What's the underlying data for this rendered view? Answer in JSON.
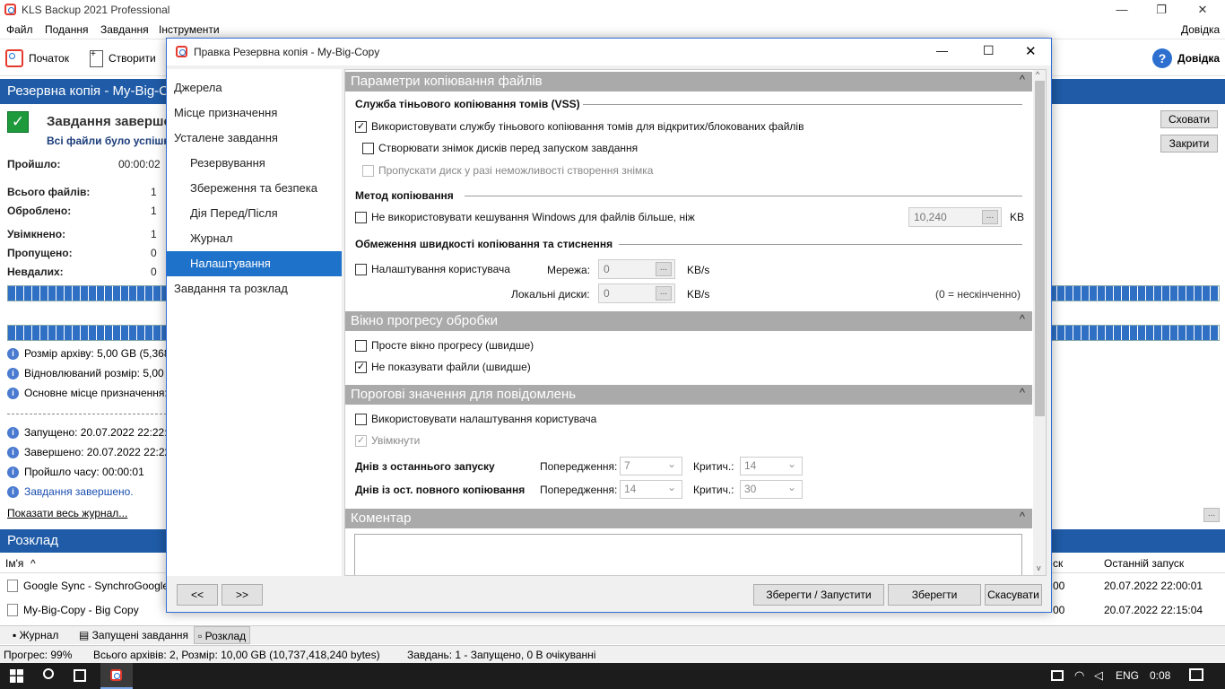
{
  "app": {
    "title": "KLS Backup 2021 Professional",
    "win_min": "—",
    "win_restore": "❐",
    "win_close": "✕"
  },
  "menu": {
    "items": [
      "Файл",
      "Подання",
      "Завдання",
      "Інструменти"
    ],
    "help": "Довідка"
  },
  "toolbar": {
    "start": "Початок",
    "create": "Створити",
    "help": "Довідка",
    "plus": "+",
    "question": "?"
  },
  "header": {
    "title": "Резервна копія - My-Big-C"
  },
  "task": {
    "status_title": "Завдання заверше",
    "status_sub": "Всі файли було успішн",
    "check": "✓"
  },
  "stats": {
    "elapsed_label": "Пройшло:",
    "elapsed_value": "00:00:02",
    "total_label": "Всього файлів:",
    "total_value": "1",
    "processed_label": "Оброблено:",
    "processed_value": "1",
    "enabled_label": "Увімкнено:",
    "enabled_value": "1",
    "skipped_label": "Пропущено:",
    "skipped_value": "0",
    "failed_label": "Невдалих:",
    "failed_value": "0"
  },
  "right_buttons": {
    "hide": "Сховати",
    "close": "Закрити"
  },
  "info": {
    "archive_size": "Розмір архіву: 5,00 GB (5,368,7",
    "restored_size": "Відновлюваний розмір: 5,00 G",
    "main_dest": "Основне місце призначення:",
    "started": "Запущено: 20.07.2022 22:22:37",
    "finished": "Завершено: 20.07.2022 22:22:3",
    "elapsed": "Пройшло часу: 00:00:01",
    "done": "Завдання завершено.",
    "show_log": "Показати весь журнал...",
    "dots": "..."
  },
  "schedule": {
    "title": "Розклад",
    "col_name": "Ім'я",
    "col_sort": "^",
    "col_sk": "ск",
    "col_last": "Останній запуск",
    "rows": [
      {
        "name": "Google Sync - SynchroGoogle",
        "mid": "00",
        "last": "20.07.2022 22:00:01"
      },
      {
        "name": "My-Big-Copy - Big Copy",
        "mid": "00",
        "last": "20.07.2022 22:15:04"
      }
    ]
  },
  "tabs": {
    "journal": "Журнал",
    "running": "Запущені завдання",
    "schedule": "Розклад"
  },
  "status": {
    "progress": "Прогрес: 99%",
    "archives": "Всього архівів: 2, Розмір: 10,00 GB (10,737,418,240 bytes)",
    "tasks": "Завдань: 1 - Запущено, 0 В очікуванні"
  },
  "taskbar": {
    "lang": "ENG",
    "time": "0:08"
  },
  "dialog": {
    "title": "Правка Резервна копія  - My-Big-Copy",
    "btn_min": "—",
    "btn_max": "☐",
    "btn_close": "✕",
    "nav": [
      "Джерела",
      "Місце призначення",
      "Усталене завдання",
      "Резервування",
      "Збереження та безпека",
      "Дія Перед/Після",
      "Журнал",
      "Налаштування",
      "Завдання та розклад"
    ],
    "sec1": "Параметри копіювання файлів",
    "vss_group": "Служба тіньового копіювання томів (VSS)",
    "vss_use": "Використовувати службу тіньового копіювання томів для відкритих/блокованих файлів",
    "vss_snapshot": "Створювати знімок дисків перед запуском завдання",
    "vss_skip": "Пропускати диск у разі неможливості створення знімка",
    "method_group": "Метод копіювання",
    "no_cache": "Не використовувати кешування Windows для файлів більше, ніж",
    "cache_value": "10,240",
    "kb": "KB",
    "limit_group": "Обмеження швидкості копіювання та стиснення",
    "user_settings": "Налаштування користувача",
    "net_label": "Мережа:",
    "net_value": "0",
    "net_unit": "KB/s",
    "local_label": "Локальні диски:",
    "local_value": "0",
    "local_unit": "KB/s",
    "infinite": "(0 = нескінченно)",
    "sec2": "Вікно прогресу обробки",
    "simple_progress": "Просте вікно прогресу (швидше)",
    "hide_files": "Не показувати файли (швидше)",
    "sec3": "Порогові значення для повідомлень",
    "use_user": "Використовувати налаштування користувача",
    "enabled": "Увімкнути",
    "days_last": "Днів з останнього запуску",
    "days_full": "Днів із ост. повного копіювання",
    "warn": "Попередження:",
    "crit": "Критич.:",
    "warn1": "7",
    "crit1": "14",
    "warn2": "14",
    "crit2": "30",
    "sec4": "Коментар",
    "prev": "<<",
    "next": ">>",
    "save_run": "Зберегти / Запустити",
    "save": "Зберегти",
    "cancel": "Скасувати",
    "collapse": "^",
    "scroll_up": "^",
    "scroll_down": "v",
    "check": "✓",
    "ellipsis": "..."
  }
}
